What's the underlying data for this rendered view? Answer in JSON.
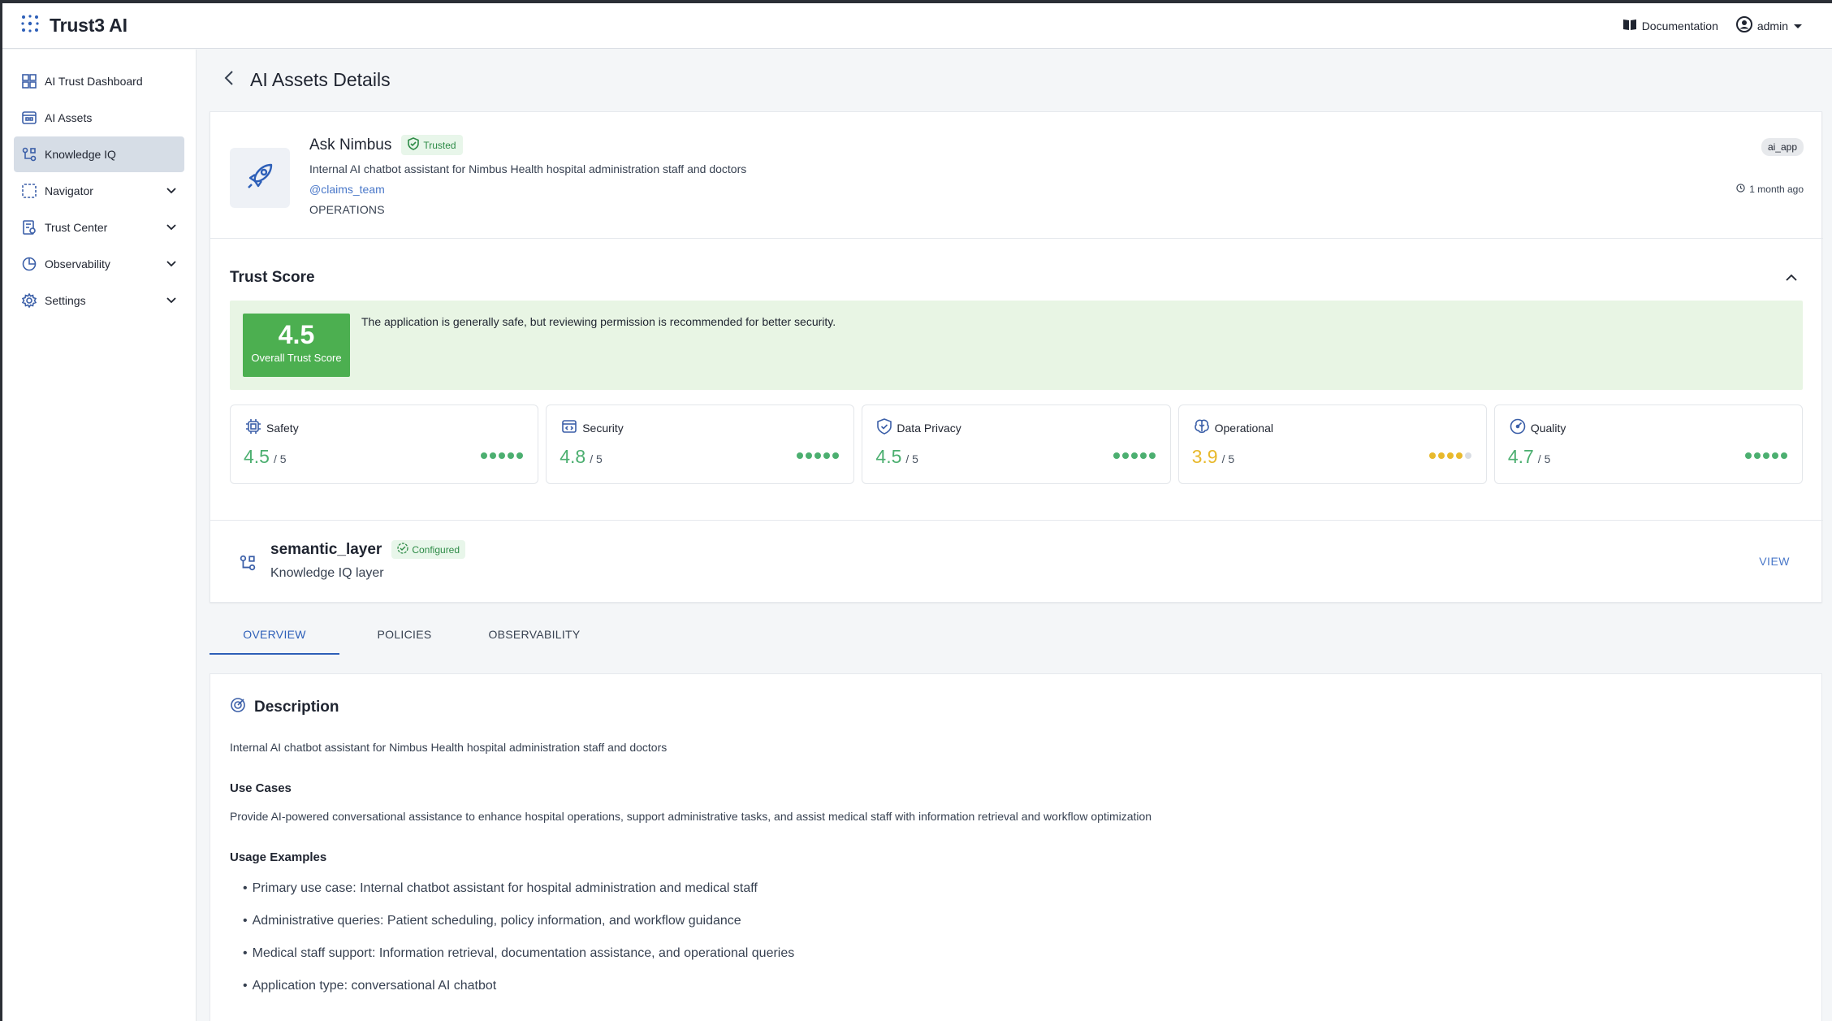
{
  "app": {
    "brand": "Trust3 AI"
  },
  "header": {
    "documentation": "Documentation",
    "user": "admin"
  },
  "sidebar": {
    "items": [
      {
        "label": "AI Trust Dashboard",
        "icon": "dashboard-icon"
      },
      {
        "label": "AI Assets",
        "icon": "assets-icon"
      },
      {
        "label": "Knowledge IQ",
        "icon": "knowledge-icon",
        "active": true
      },
      {
        "label": "Navigator",
        "icon": "navigator-icon",
        "expandable": true
      },
      {
        "label": "Trust Center",
        "icon": "trust-center-icon",
        "expandable": true
      },
      {
        "label": "Observability",
        "icon": "observability-icon",
        "expandable": true
      },
      {
        "label": "Settings",
        "icon": "settings-icon",
        "expandable": true
      }
    ]
  },
  "page": {
    "title": "AI Assets Details"
  },
  "asset": {
    "name": "Ask Nimbus",
    "badge": "Trusted",
    "description": "Internal AI chatbot assistant for Nimbus Health hospital administration staff and doctors",
    "team": "@claims_team",
    "department": "OPERATIONS",
    "type": "ai_app",
    "updated": "1 month ago"
  },
  "trust_score": {
    "title": "Trust Score",
    "score": "4.5",
    "score_label": "Overall Trust Score",
    "message": "The application is generally safe, but reviewing permission is recommended for better security.",
    "metrics": [
      {
        "name": "Safety",
        "value": "4.5",
        "max": "/ 5",
        "dots_filled": 5,
        "color": "#4caf70"
      },
      {
        "name": "Security",
        "value": "4.8",
        "max": "/ 5",
        "dots_filled": 5,
        "color": "#4caf70"
      },
      {
        "name": "Data Privacy",
        "value": "4.5",
        "max": "/ 5",
        "dots_filled": 5,
        "color": "#4caf70"
      },
      {
        "name": "Operational",
        "value": "3.9",
        "max": "/ 5",
        "dots_filled": 4,
        "color": "#e8b92c"
      },
      {
        "name": "Quality",
        "value": "4.7",
        "max": "/ 5",
        "dots_filled": 5,
        "color": "#4caf70"
      }
    ]
  },
  "semantic": {
    "name": "semantic_layer",
    "badge": "Configured",
    "subtitle": "Knowledge IQ layer",
    "view": "VIEW"
  },
  "tabs": [
    {
      "label": "OVERVIEW",
      "active": true
    },
    {
      "label": "POLICIES"
    },
    {
      "label": "OBSERVABILITY"
    }
  ],
  "overview": {
    "title": "Description",
    "description": "Internal AI chatbot assistant for Nimbus Health hospital administration staff and doctors",
    "use_cases_title": "Use Cases",
    "use_cases": "Provide AI-powered conversational assistance to enhance hospital operations, support administrative tasks, and assist medical staff with information retrieval and workflow optimization",
    "usage_examples_title": "Usage Examples",
    "usage_examples": [
      "Primary use case: Internal chatbot assistant for hospital administration and medical staff",
      "Administrative queries: Patient scheduling, policy information, and workflow guidance",
      "Medical staff support: Information retrieval, documentation assistance, and operational queries",
      "Application type: conversational AI chatbot"
    ]
  },
  "colors": {
    "accent": "#2d5fb8",
    "success": "#4caf50",
    "warning": "#e8b92c",
    "link": "#4a78c9"
  }
}
